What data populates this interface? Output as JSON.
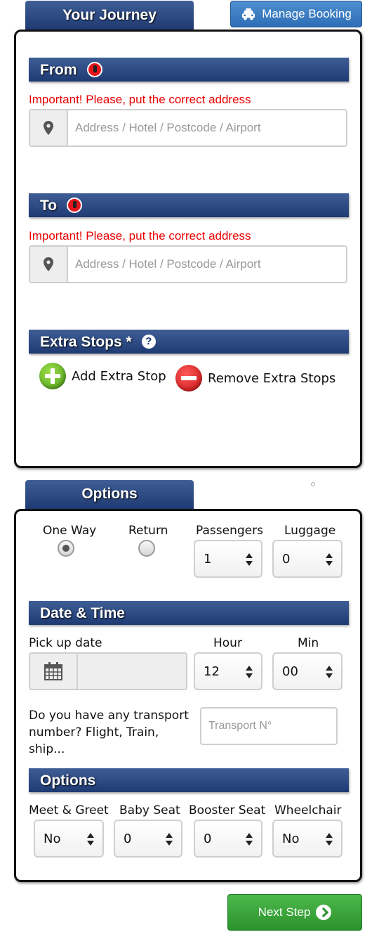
{
  "journey": {
    "tab_label": "Your Journey",
    "manage_booking_label": "Manage Booking",
    "from": {
      "title": "From",
      "warning": "Important! Please, put the correct address",
      "placeholder": "Address / Hotel / Postcode / Airport"
    },
    "to": {
      "title": "To",
      "warning": "Important! Please, put the correct address",
      "placeholder": "Address / Hotel / Postcode / Airport"
    },
    "extra_stops": {
      "title": "Extra Stops *",
      "add_label": "Add Extra Stop",
      "remove_label": "Remove Extra Stops"
    }
  },
  "options": {
    "tab_label": "Options",
    "one_way_label": "One Way",
    "return_label": "Return",
    "trip_type_selected": "One Way",
    "passengers_label": "Passengers",
    "passengers_value": "1",
    "luggage_label": "Luggage",
    "luggage_value": "0",
    "date_time": {
      "title": "Date & Time",
      "pickup_label": "Pick up date",
      "hour_label": "Hour",
      "hour_value": "12",
      "min_label": "Min",
      "min_value": "00",
      "transport_question": "Do you have any transport number? Flight, Train, ship...",
      "transport_placeholder": "Transport N°"
    },
    "extras": {
      "title": "Options",
      "meet_greet_label": "Meet & Greet",
      "meet_greet_value": "No",
      "baby_seat_label": "Baby Seat",
      "baby_seat_value": "0",
      "booster_seat_label": "Booster Seat",
      "booster_seat_value": "0",
      "wheelchair_label": "Wheelchair",
      "wheelchair_value": "No"
    }
  },
  "next_step_label": "Next Step",
  "colors": {
    "header_blue": "#1f3a72",
    "warning_red": "#e80000",
    "next_green": "#2b932b",
    "manage_blue": "#2e6eb6"
  }
}
